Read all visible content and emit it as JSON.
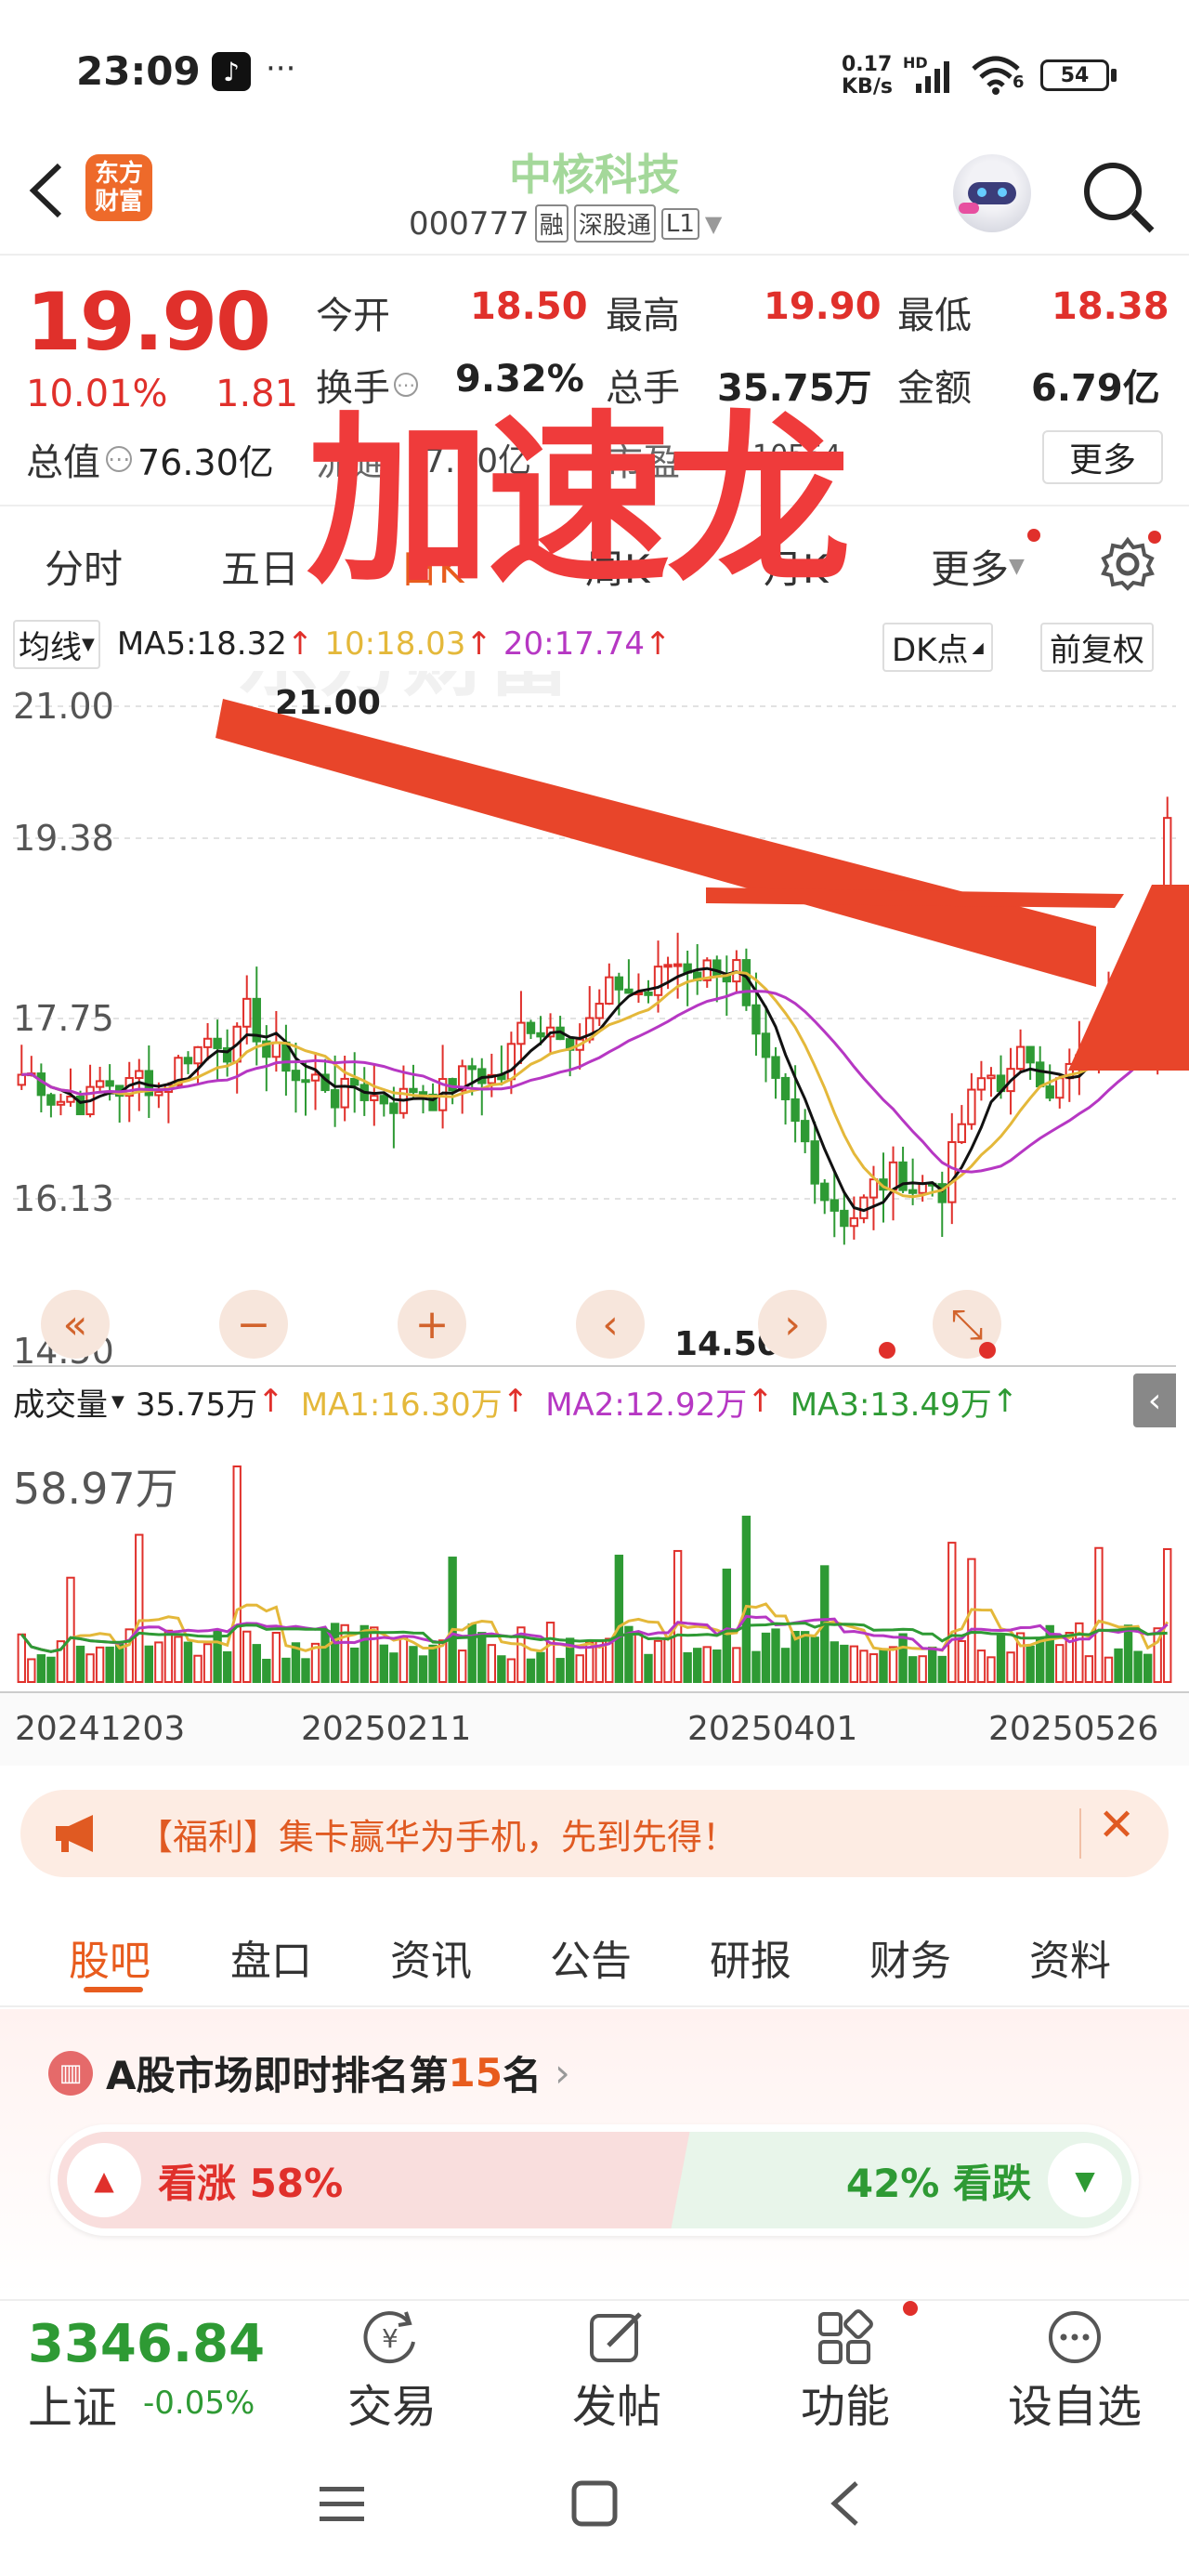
{
  "status_bar": {
    "time": "23:09",
    "dots": "···",
    "net_speed": "0.17",
    "net_unit": "KB/s",
    "hd": "HD",
    "wifi_gen": "6",
    "battery": "54"
  },
  "header": {
    "logo": "东方财富",
    "stock_name": "中核科技",
    "stock_code": "000777",
    "badges": [
      "融",
      "深股通",
      "L1"
    ]
  },
  "quote": {
    "price": "19.90",
    "change_pct": "10.01%",
    "change_amt": "1.81",
    "market_cap_label": "总值",
    "market_cap": "76.30亿",
    "fields": [
      {
        "label": "今开",
        "value": "18.50",
        "color": "#e0302b"
      },
      {
        "label": "最高",
        "value": "19.90",
        "color": "#e0302b"
      },
      {
        "label": "最低",
        "value": "18.38",
        "color": "#e0302b"
      },
      {
        "label": "换手",
        "value": "9.32%",
        "color": "#222222"
      },
      {
        "label": "总手",
        "value": "35.75万",
        "color": "#222222"
      },
      {
        "label": "金额",
        "value": "6.79亿",
        "color": "#222222"
      }
    ],
    "row3_partial": "流通",
    "row3_value_partial": "7.30亿",
    "row3_label2_partial": "市盈",
    "row3_value2_partial": "10554",
    "more_button": "更多"
  },
  "overlay": {
    "caption": "加速龙",
    "caption_color": "#ef3b3b",
    "arrow_color": "#e8452a"
  },
  "period_tabs": [
    "分时",
    "五日",
    "日K",
    "周K",
    "月K",
    "更多"
  ],
  "kline": {
    "ma_selector": "均线",
    "ma5": "MA5:18.32",
    "ma10": "10:18.03",
    "ma20": "20:17.74",
    "dk_button": "DK点",
    "adjust_button": "前复权",
    "y_labels": [
      "21.00",
      "19.38",
      "17.75",
      "16.13",
      "14.50"
    ],
    "high_marker": "21.00",
    "low_marker": "14.50->",
    "controls": [
      "«",
      "−",
      "+",
      "‹",
      "›",
      "⤡"
    ]
  },
  "volume": {
    "selector": "成交量",
    "value": "35.75万",
    "ma1": "MA1:16.30万",
    "ma2": "MA2:12.92万",
    "ma3": "MA3:13.49万",
    "max_label": "58.97万",
    "dates": [
      "20241203",
      "20250211",
      "20250401",
      "20250526"
    ]
  },
  "banner": {
    "text": "【福利】集卡赢华为手机，先到先得！"
  },
  "content_tabs": [
    "股吧",
    "盘口",
    "资讯",
    "公告",
    "研报",
    "财务",
    "资料"
  ],
  "ranking": {
    "prefix": "A股市场即时排名第",
    "rank": "15",
    "suffix": "名"
  },
  "vote": {
    "up_label": "看涨 58%",
    "down_label": "42% 看跌",
    "up_ratio": 0.58
  },
  "bottom_bar": {
    "index_value": "3346.84",
    "index_name": "上证",
    "index_change": "-0.05%",
    "items": [
      "交易",
      "发帖",
      "功能",
      "设自选"
    ]
  },
  "colors": {
    "up": "#e0302b",
    "down": "#2e9a34",
    "accent": "#e85c1e",
    "brand_green": "#a4d89a"
  }
}
